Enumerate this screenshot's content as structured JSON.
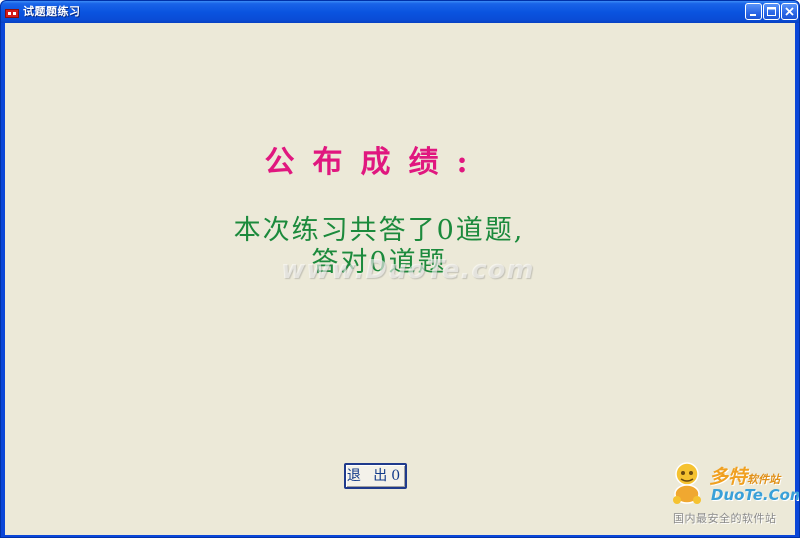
{
  "window": {
    "title": "试题题练习",
    "controls": {
      "minimize": "minimize-icon",
      "maximize": "maximize-icon",
      "close": "close-icon"
    }
  },
  "main": {
    "heading": "公布成绩:",
    "result_line1": "本次练习共答了0道题,",
    "result_line2": "答对0道题",
    "exit_button": "退 出0"
  },
  "watermark": {
    "center_text": "www.DuoTe.com",
    "logo_name": "多特",
    "logo_suffix": "软件站",
    "logo_site": "DuoTe.Com",
    "logo_tagline": "国内最安全的软件站"
  },
  "colors": {
    "heading": "#e0177f",
    "result": "#1c8a3c",
    "client_bg": "#ece9d8",
    "titlebar": "#0a54e0"
  }
}
